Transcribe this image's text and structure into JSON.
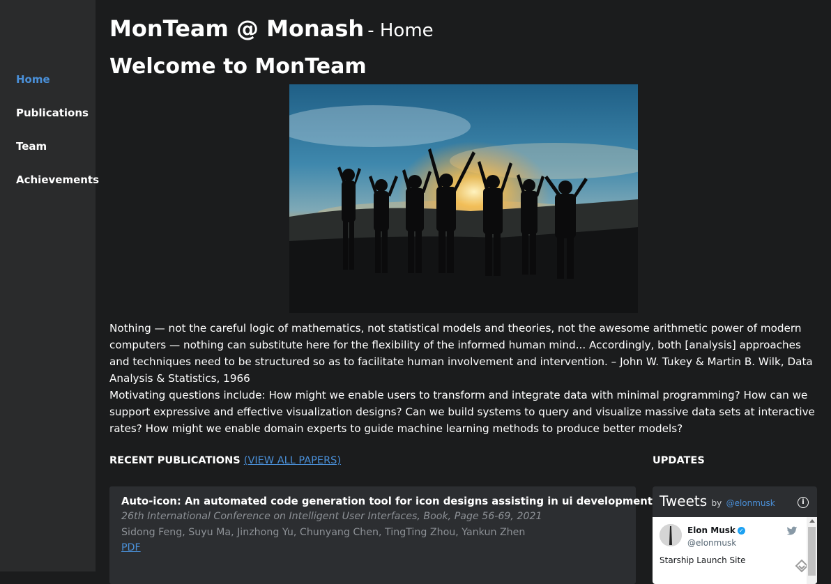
{
  "nav": {
    "items": [
      {
        "label": "Home",
        "active": true
      },
      {
        "label": "Publications",
        "active": false
      },
      {
        "label": "Team",
        "active": false
      },
      {
        "label": "Achievements",
        "active": false
      }
    ]
  },
  "header": {
    "site_name": "MonTeam @ Monash",
    "page_suffix": "- Home",
    "welcome": "Welcome to MonTeam"
  },
  "intro": {
    "quote": "Nothing — not the careful logic of mathematics, not statistical models and theories, not the awesome arithmetic power of modern computers — nothing can substitute here for the flexibility of the informed human mind... Accordingly, both [analysis] approaches and techniques need to be structured so as to facilitate human involvement and intervention. – John W. Tukey & Martin B. Wilk, Data Analysis & Statistics, 1966",
    "questions": "Motivating questions include: How might we enable users to transform and integrate data with minimal programming? How can we support expressive and effective visualization designs? Can we build systems to query and visualize massive data sets at interactive rates? How might we enable domain experts to guide machine learning methods to produce better models?"
  },
  "publications": {
    "heading": "RECENT PUBLICATIONS",
    "view_all": "(VIEW ALL PAPERS)",
    "items": [
      {
        "title": "Auto-icon: An automated code generation tool for icon designs assisting in ui development",
        "venue": "26th International Conference on Intelligent User Interfaces, Book, Page 56-69, 2021",
        "authors": "Sidong Feng, Suyu Ma, Jinzhong Yu, Chunyang Chen, TingTing Zhou, Yankun Zhen",
        "link": "PDF"
      }
    ]
  },
  "updates": {
    "heading": "UPDATES",
    "widget": {
      "title": "Tweets",
      "by": "by",
      "handle": "@elonmusk",
      "tweet": {
        "name": "Elon Musk",
        "username": "@elonmusk",
        "text": "Starship Launch Site"
      }
    }
  },
  "colors": {
    "background": "#1b1c1d",
    "sidebar": "#2a2b2c",
    "accent": "#4a90d9",
    "card": "#2c2e31",
    "muted_text": "#8d9196"
  }
}
